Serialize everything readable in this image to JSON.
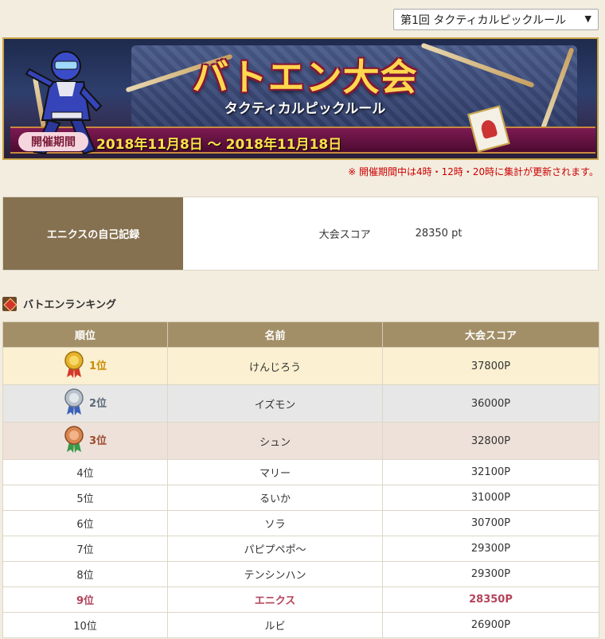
{
  "selector": {
    "selected": "第1回 タクティカルピックルール",
    "arrow": "▼"
  },
  "banner": {
    "title": "バトエン大会",
    "subtitle": "タクティカルピックルール",
    "period_label": "開催期間",
    "period_dates": "2018年11月8日 〜 2018年11月18日"
  },
  "notice": "※ 開催期間中は4時・12時・20時に集計が更新されます。",
  "record": {
    "label": "エニクスの自己記録",
    "score_label": "大会スコア",
    "score_value": "28350 pt"
  },
  "ranking": {
    "heading": "バトエンランキング",
    "columns": [
      "順位",
      "名前",
      "大会スコア"
    ],
    "rows": [
      {
        "rank": "1位",
        "name": "けんじろう",
        "score": "37800P",
        "medal": "gold"
      },
      {
        "rank": "2位",
        "name": "イズモン",
        "score": "36000P",
        "medal": "silver"
      },
      {
        "rank": "3位",
        "name": "シュン",
        "score": "32800P",
        "medal": "bronze"
      },
      {
        "rank": "4位",
        "name": "マリー",
        "score": "32100P"
      },
      {
        "rank": "5位",
        "name": "るいか",
        "score": "31000P"
      },
      {
        "rank": "6位",
        "name": "ソラ",
        "score": "30700P"
      },
      {
        "rank": "7位",
        "name": "パピプペポ〜",
        "score": "29300P"
      },
      {
        "rank": "8位",
        "name": "テンシンハン",
        "score": "29300P"
      },
      {
        "rank": "9位",
        "name": "エニクス",
        "score": "28350P",
        "self": true
      },
      {
        "rank": "10位",
        "name": "ルビ",
        "score": "26900P"
      }
    ]
  },
  "colors": {
    "header_bg": "#a38f67",
    "record_label_bg": "#85704f",
    "self_highlight": "#b3435a",
    "notice": "#cc0000"
  }
}
